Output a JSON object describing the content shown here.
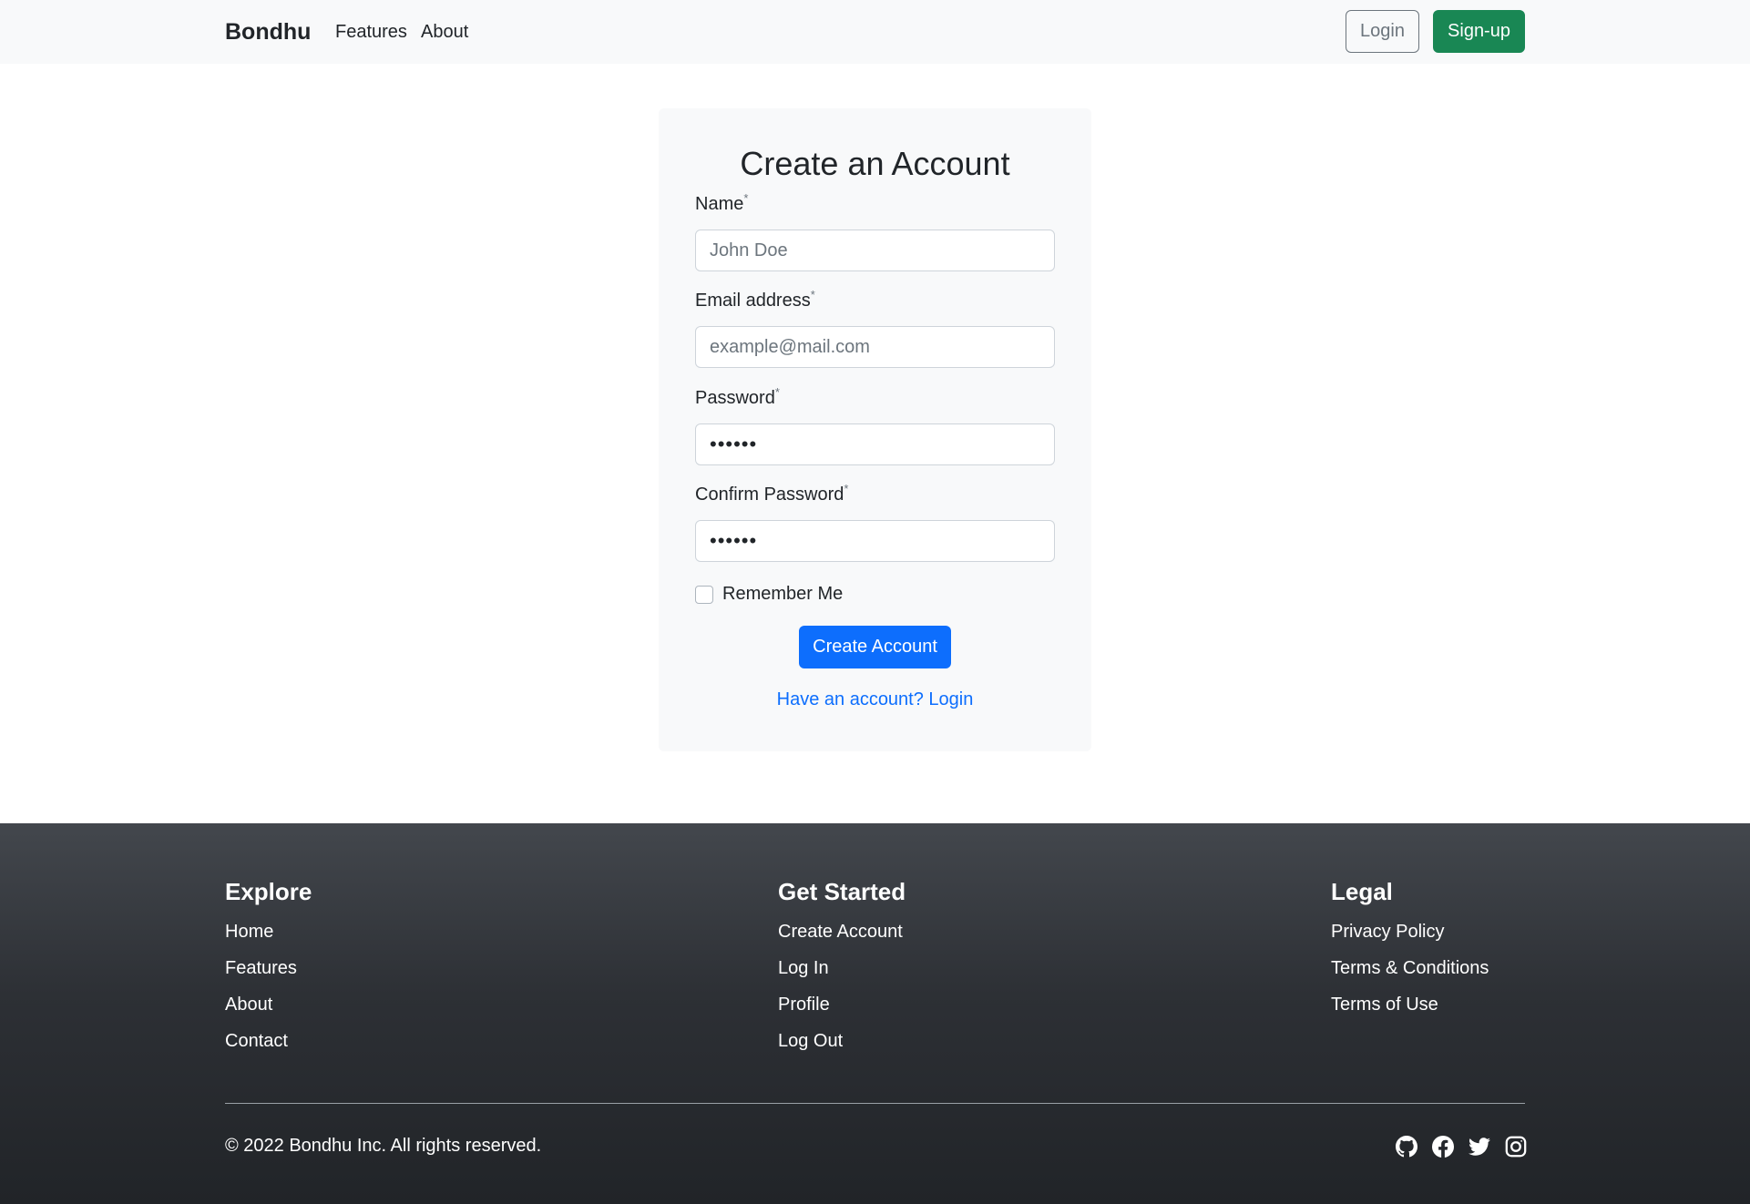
{
  "navbar": {
    "brand": "Bondhu",
    "links": [
      "Features",
      "About"
    ],
    "login_label": "Login",
    "signup_label": "Sign-up"
  },
  "form": {
    "title": "Create an Account",
    "required_mark": "*",
    "fields": [
      {
        "label": "Name",
        "placeholder": "John Doe",
        "value": ""
      },
      {
        "label": "Email address",
        "placeholder": "example@mail.com",
        "value": ""
      },
      {
        "label": "Password",
        "placeholder": "",
        "value": "••••••"
      },
      {
        "label": "Confirm Password",
        "placeholder": "",
        "value": "••••••"
      }
    ],
    "remember_label": "Remember Me",
    "remember_checked": false,
    "submit_label": "Create Account",
    "login_link": "Have an account? Login"
  },
  "footer": {
    "columns": [
      {
        "heading": "Explore",
        "links": [
          "Home",
          "Features",
          "About",
          "Contact"
        ]
      },
      {
        "heading": "Get Started",
        "links": [
          "Create Account",
          "Log In",
          "Profile",
          "Log Out"
        ]
      },
      {
        "heading": "Legal",
        "links": [
          "Privacy Policy",
          "Terms & Conditions",
          "Terms of Use"
        ]
      }
    ],
    "copyright": "© 2022 Bondhu Inc. All rights reserved.",
    "socials": [
      "github-icon",
      "facebook-icon",
      "twitter-icon",
      "instagram-icon"
    ]
  },
  "colors": {
    "primary": "#0d6efd",
    "success": "#198754",
    "navbar_bg": "#f8f9fa",
    "footer_bg": "#212529"
  }
}
